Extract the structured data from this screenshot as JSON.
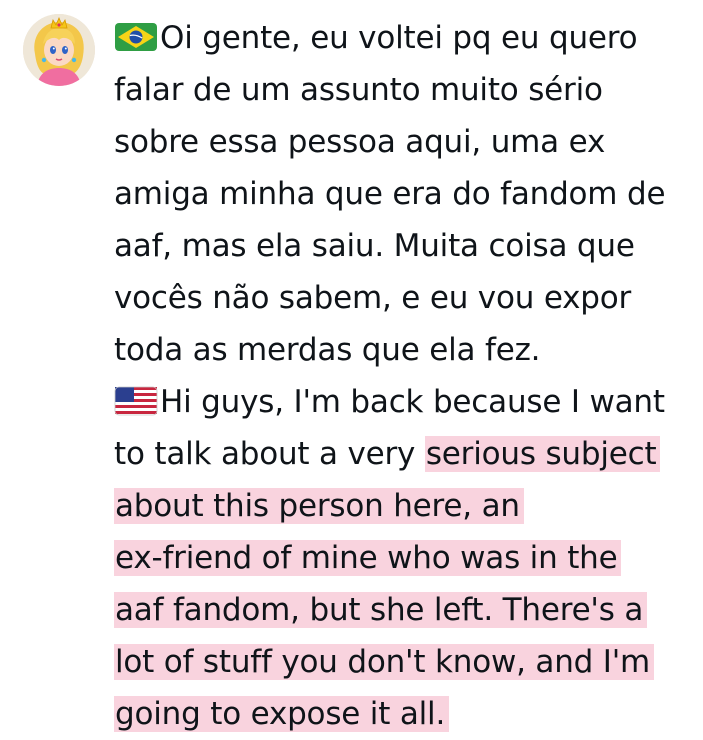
{
  "author": {
    "avatar_icon": "princess-peach-avatar-icon"
  },
  "post": {
    "flag_br": "flag-brazil-icon",
    "flag_us": "flag-usa-icon",
    "highlight_color": "#f9d3de",
    "lines": [
      "Oi gente, eu voltei pq eu quero",
      "falar de um assunto muito sério",
      "sobre essa pessoa aqui, uma ex",
      "amiga minha que era do fandom de",
      "aaf, mas ela saiu. Muita coisa que",
      "vocês não sabem, e eu vou expor",
      "toda as merdas que ela fez.",
      "Hi guys, I'm back because I want",
      "to talk about a very ",
      "serious subject",
      "about this person here, an",
      "ex-friend of mine who was in the",
      "aaf fandom, but she left. There's a",
      "lot of stuff you don't know, and I'm",
      "going to expose it all."
    ]
  }
}
